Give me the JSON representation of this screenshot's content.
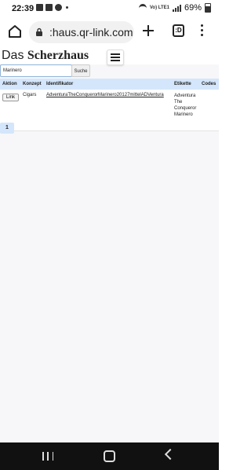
{
  "status_bar": {
    "time": "22:39",
    "battery": "69%",
    "network": "Vo) LTE1",
    "notification_icons": [
      "gallery-icon",
      "image-icon",
      "whatsapp-icon",
      "dot-icon"
    ]
  },
  "browser": {
    "url": ":haus.qr-link.com",
    "tab_count": ":D"
  },
  "site": {
    "brand_prefix": "Das",
    "brand_name": "Scherzhaus"
  },
  "search": {
    "value": "Marinero",
    "button_label": "Suche"
  },
  "table": {
    "headers": {
      "aktion": "Aktion",
      "konzept": "Konzept",
      "identifikator": "Identifikator",
      "etikette": "Etikette",
      "codes": "Codes"
    },
    "rows": [
      {
        "action_label": "Link",
        "konzept": "Cigars",
        "identifikator": "AdventuraTheConquerorMarinero20127mittelADVentura",
        "etikette_lines": [
          "Adventura",
          "The",
          "Conqueror",
          "Marinero"
        ],
        "codes": ""
      }
    ]
  },
  "pagination": {
    "current_page": "1"
  },
  "colors": {
    "header_bg": "#d4e6fb",
    "page_bg": "#f7f7f9",
    "navbar_bg": "#111111"
  }
}
